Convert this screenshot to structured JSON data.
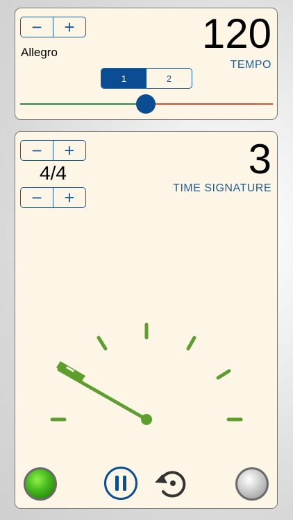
{
  "tempo": {
    "minus_label": "−",
    "plus_label": "+",
    "name": "Allegro",
    "value": "120",
    "caption": "TEMPO",
    "segments": [
      "1",
      "2"
    ],
    "selected_segment": "1",
    "slider_fraction": 0.5
  },
  "meter": {
    "minus_label": "−",
    "plus_label": "+",
    "signature": "4/4",
    "count": "3",
    "caption": "TIME SIGNATURE"
  },
  "colors": {
    "card_bg": "#fdf5e6",
    "accent_blue": "#0a4d92",
    "dial_green": "#5e9e2f",
    "track_green": "#1f8a4a",
    "track_red": "#d8502b"
  },
  "icons": {
    "play_light": "green-light-icon",
    "pause": "pause-icon",
    "reset": "reset-icon",
    "stop_light": "gray-light-icon"
  }
}
